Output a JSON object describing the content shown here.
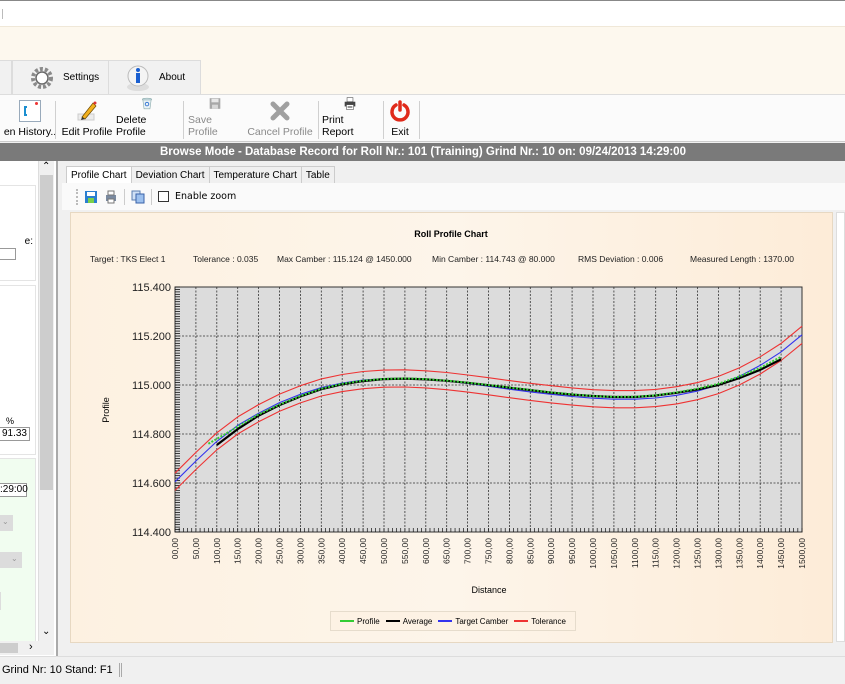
{
  "ribbon": {
    "tabs": [
      {
        "label": "Settings",
        "icon": "gear-icon"
      },
      {
        "label": "About",
        "icon": "info-icon"
      }
    ]
  },
  "toolbar": {
    "buttons": [
      {
        "label": "en History..",
        "icon": "history-icon",
        "enabled": true
      },
      {
        "label": "Edit Profile",
        "icon": "pencil-icon",
        "enabled": true
      },
      {
        "label": "Delete Profile",
        "icon": "recycle-bin-icon",
        "enabled": true
      },
      {
        "label": "Save Profile",
        "icon": "floppy-disk-icon",
        "enabled": false
      },
      {
        "label": "Cancel Profile",
        "icon": "x-icon",
        "enabled": false
      },
      {
        "label": "Print Report",
        "icon": "printer-icon",
        "enabled": true
      },
      {
        "label": "Exit",
        "icon": "power-icon",
        "enabled": true
      }
    ]
  },
  "modebar": {
    "text": "Browse Mode - Database Record for Roll Nr.: 101 (Training) Grind Nr.: 10 on: 09/24/2013 14:29:00"
  },
  "leftpanel": {
    "label_fragment": "e:",
    "percent_label": "%",
    "percent_value": "91.33",
    "time_value": ":29:00"
  },
  "chart_tabs": [
    {
      "label": "Profile Chart",
      "active": true
    },
    {
      "label": "Deviation Chart",
      "active": false
    },
    {
      "label": "Temperature Chart",
      "active": false
    },
    {
      "label": "Table",
      "active": false
    }
  ],
  "chart_toolbar": {
    "enable_zoom_label": "Enable zoom",
    "enable_zoom_checked": false
  },
  "statusbar": {
    "text": "Grind Nr: 10  Stand: F1"
  },
  "chart_data": {
    "type": "line",
    "title": "Roll Profile Chart",
    "info": {
      "target": "Target : TKS Elect 1",
      "tolerance": "Tolerance : 0.035",
      "max_camber": "Max Camber : 115.124 @ 1450.000",
      "min_camber": "Min Camber : 114.743 @ 80.000",
      "rms_deviation": "RMS Deviation : 0.006",
      "measured_length": "Measured Length : 1370.00"
    },
    "xlabel": "Distance",
    "ylabel": "Profile",
    "xlim": [
      0,
      1500
    ],
    "ylim": [
      114.4,
      115.4
    ],
    "grid": true,
    "x_ticks": [
      "00,00",
      "50,00",
      "100,00",
      "150,00",
      "200,00",
      "250,00",
      "300,00",
      "350,00",
      "400,00",
      "450,00",
      "500,00",
      "550,00",
      "600,00",
      "650,00",
      "700,00",
      "750,00",
      "800,00",
      "850,00",
      "900,00",
      "950,00",
      "1000,00",
      "1050,00",
      "1100,00",
      "1150,00",
      "1200,00",
      "1250,00",
      "1300,00",
      "1350,00",
      "1400,00",
      "1450,00",
      "1500,00"
    ],
    "y_ticks": [
      "114.400",
      "114.600",
      "114.800",
      "115.000",
      "115.200",
      "115.400"
    ],
    "legend_position": "bottom",
    "series": [
      {
        "name": "Profile",
        "color": "#33cc33",
        "style": "dotted",
        "x": [
          80,
          150,
          200,
          250,
          300,
          350,
          400,
          450,
          500,
          550,
          600,
          650,
          700,
          750,
          800,
          850,
          900,
          950,
          1000,
          1050,
          1100,
          1150,
          1200,
          1250,
          1300,
          1350,
          1400,
          1450
        ],
        "y": [
          114.76,
          114.83,
          114.88,
          114.92,
          114.955,
          114.985,
          115.005,
          115.018,
          115.025,
          115.027,
          115.024,
          115.018,
          115.01,
          115.0,
          114.99,
          114.98,
          114.97,
          114.962,
          114.955,
          114.952,
          114.952,
          114.958,
          114.97,
          114.985,
          115.005,
          115.035,
          115.07,
          115.115
        ]
      },
      {
        "name": "Average",
        "color": "#000000",
        "style": "solid",
        "x": [
          100,
          150,
          200,
          250,
          300,
          350,
          400,
          450,
          500,
          550,
          600,
          650,
          700,
          750,
          800,
          850,
          900,
          950,
          1000,
          1050,
          1100,
          1150,
          1200,
          1250,
          1300,
          1350,
          1400,
          1450
        ],
        "y": [
          114.755,
          114.82,
          114.875,
          114.918,
          114.953,
          114.983,
          115.003,
          115.016,
          115.024,
          115.026,
          115.023,
          115.017,
          115.009,
          114.999,
          114.989,
          114.979,
          114.969,
          114.961,
          114.955,
          114.951,
          114.951,
          114.957,
          114.968,
          114.982,
          115.0,
          115.028,
          115.062,
          115.105
        ]
      },
      {
        "name": "Target Camber",
        "color": "#3333ee",
        "style": "solid",
        "x": [
          0,
          50,
          100,
          150,
          200,
          250,
          300,
          350,
          400,
          450,
          500,
          550,
          600,
          650,
          700,
          750,
          800,
          850,
          900,
          950,
          1000,
          1050,
          1100,
          1150,
          1200,
          1250,
          1300,
          1350,
          1400,
          1450,
          1500
        ],
        "y": [
          114.605,
          114.69,
          114.77,
          114.835,
          114.885,
          114.928,
          114.962,
          114.99,
          115.008,
          115.02,
          115.026,
          115.027,
          115.023,
          115.016,
          115.006,
          114.995,
          114.983,
          114.972,
          114.962,
          114.953,
          114.946,
          114.942,
          114.942,
          114.947,
          114.958,
          114.975,
          115.0,
          115.035,
          115.08,
          115.135,
          115.205
        ]
      },
      {
        "name": "Tolerance",
        "color": "#ee3333",
        "style": "solid",
        "x": [
          0,
          50,
          100,
          150,
          200,
          250,
          300,
          350,
          400,
          450,
          500,
          550,
          600,
          650,
          700,
          750,
          800,
          850,
          900,
          950,
          1000,
          1050,
          1100,
          1150,
          1200,
          1250,
          1300,
          1350,
          1400,
          1450,
          1500
        ],
        "y": [
          114.64,
          114.725,
          114.805,
          114.87,
          114.92,
          114.963,
          114.997,
          115.025,
          115.043,
          115.055,
          115.061,
          115.062,
          115.058,
          115.051,
          115.041,
          115.03,
          115.018,
          115.007,
          114.997,
          114.988,
          114.981,
          114.977,
          114.977,
          114.982,
          114.993,
          115.01,
          115.035,
          115.07,
          115.115,
          115.17,
          115.24
        ]
      },
      {
        "name": "Tolerance (lower)",
        "color": "#ee3333",
        "style": "solid",
        "x": [
          0,
          50,
          100,
          150,
          200,
          250,
          300,
          350,
          400,
          450,
          500,
          550,
          600,
          650,
          700,
          750,
          800,
          850,
          900,
          950,
          1000,
          1050,
          1100,
          1150,
          1200,
          1250,
          1300,
          1350,
          1400,
          1450,
          1500
        ],
        "y": [
          114.57,
          114.655,
          114.735,
          114.8,
          114.85,
          114.893,
          114.927,
          114.955,
          114.973,
          114.985,
          114.991,
          114.992,
          114.988,
          114.981,
          114.971,
          114.96,
          114.948,
          114.937,
          114.927,
          114.918,
          114.911,
          114.907,
          114.907,
          114.912,
          114.923,
          114.94,
          114.965,
          115.0,
          115.045,
          115.1,
          115.17
        ]
      }
    ],
    "legend": [
      "Profile",
      "Average",
      "Target Camber",
      "Tolerance"
    ]
  }
}
